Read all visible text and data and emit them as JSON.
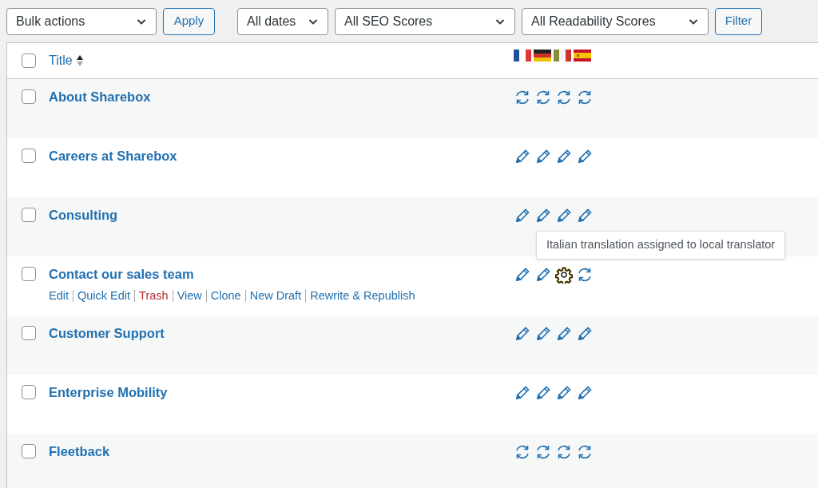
{
  "toolbar": {
    "bulk_actions": "Bulk actions",
    "apply": "Apply",
    "dates": "All dates",
    "seo": "All SEO Scores",
    "readability": "All Readability Scores",
    "filter": "Filter"
  },
  "table": {
    "header": {
      "checked": false,
      "title": "Title",
      "languages": [
        {
          "kind": "fr"
        },
        {
          "kind": "de"
        },
        {
          "kind": "it"
        },
        {
          "kind": "es"
        }
      ]
    },
    "rows": [
      {
        "title": "About Sharebox",
        "checked": false,
        "languages": [
          {
            "kind": "sync"
          },
          {
            "kind": "sync"
          },
          {
            "kind": "sync"
          },
          {
            "kind": "sync"
          }
        ]
      },
      {
        "title": "Careers at Sharebox",
        "checked": false,
        "languages": [
          {
            "kind": "edit"
          },
          {
            "kind": "edit"
          },
          {
            "kind": "edit"
          },
          {
            "kind": "edit"
          }
        ]
      },
      {
        "title": "Consulting",
        "checked": false,
        "languages": [
          {
            "kind": "edit"
          },
          {
            "kind": "edit"
          },
          {
            "kind": "edit"
          },
          {
            "kind": "edit"
          }
        ]
      },
      {
        "title": "Contact our sales team",
        "checked": false,
        "languages": [
          {
            "kind": "edit"
          },
          {
            "kind": "edit"
          },
          {
            "kind": "gear",
            "tooltip": "Italian translation assigned to local translator"
          },
          {
            "kind": "sync"
          }
        ],
        "actions": [
          {
            "label": "Edit",
            "kind": "normal"
          },
          {
            "label": "Quick Edit",
            "kind": "normal"
          },
          {
            "label": "Trash",
            "kind": "delete"
          },
          {
            "label": "View",
            "kind": "normal"
          },
          {
            "label": "Clone",
            "kind": "normal"
          },
          {
            "label": "New Draft",
            "kind": "normal"
          },
          {
            "label": "Rewrite & Republish",
            "kind": "normal"
          }
        ]
      },
      {
        "title": "Customer Support",
        "checked": false,
        "languages": [
          {
            "kind": "edit"
          },
          {
            "kind": "edit"
          },
          {
            "kind": "edit"
          },
          {
            "kind": "edit"
          }
        ]
      },
      {
        "title": "Enterprise Mobility",
        "checked": false,
        "languages": [
          {
            "kind": "edit"
          },
          {
            "kind": "edit"
          },
          {
            "kind": "edit"
          },
          {
            "kind": "edit"
          }
        ]
      },
      {
        "title": "Fleetback",
        "checked": false,
        "languages": [
          {
            "kind": "sync"
          },
          {
            "kind": "sync"
          },
          {
            "kind": "sync"
          },
          {
            "kind": "sync"
          }
        ]
      }
    ]
  }
}
